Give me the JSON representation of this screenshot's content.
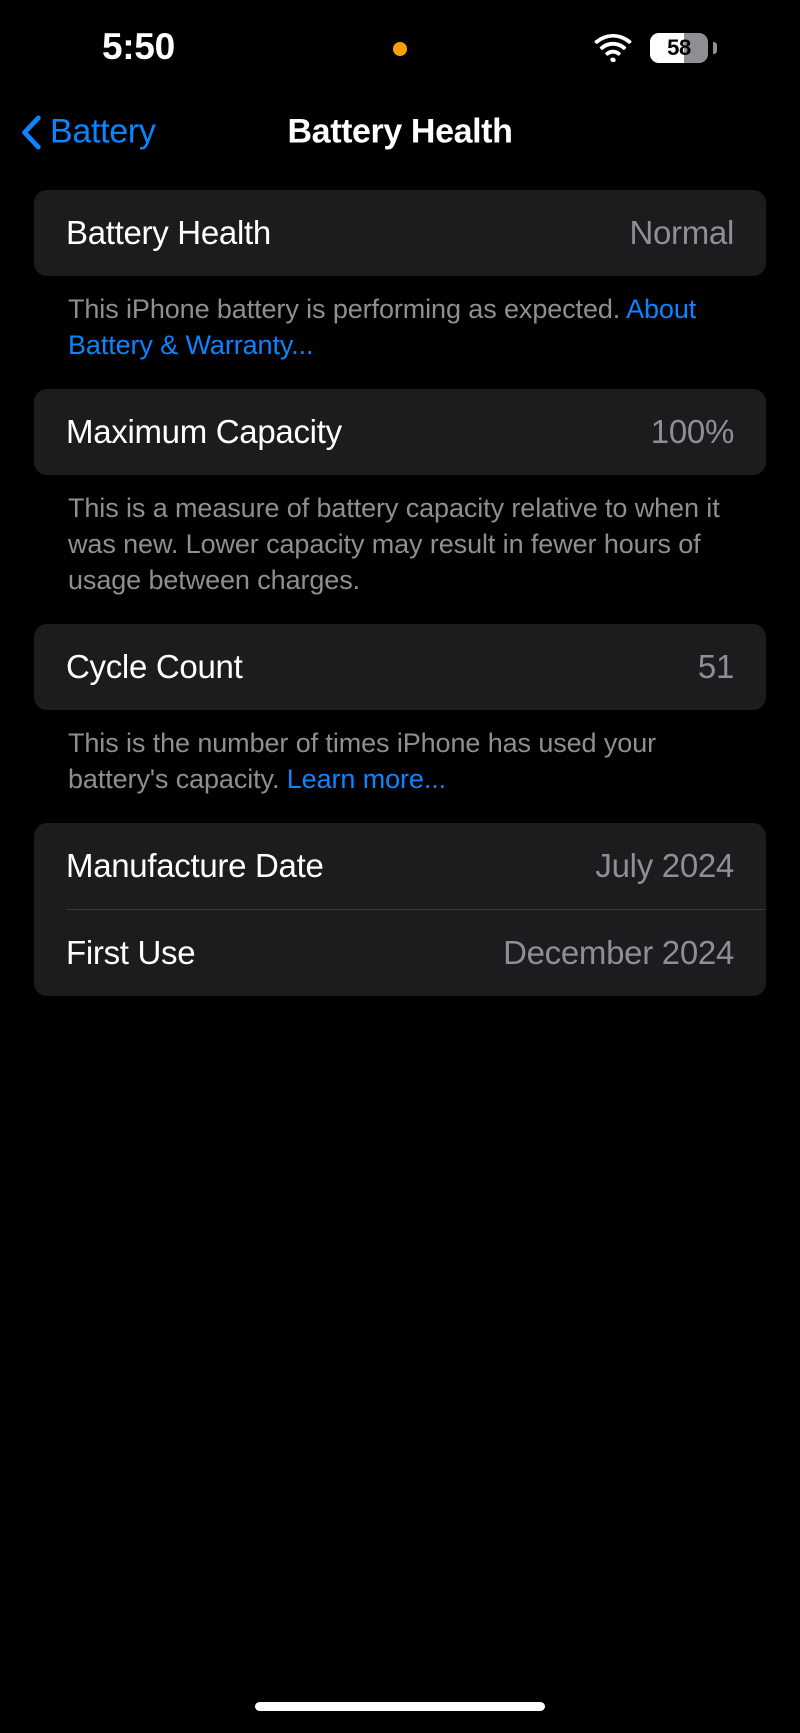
{
  "status_bar": {
    "time": "5:50",
    "privacy_indicator": "orange-dot",
    "wifi": "wifi-icon",
    "battery_percent_label": "58",
    "battery_level": 58
  },
  "nav": {
    "back_label": "Battery",
    "title": "Battery Health"
  },
  "sections": [
    {
      "rows": [
        {
          "label": "Battery Health",
          "value": "Normal"
        }
      ],
      "footer": {
        "text": "This iPhone battery is performing as expected. ",
        "link": "About Battery & Warranty..."
      }
    },
    {
      "rows": [
        {
          "label": "Maximum Capacity",
          "value": "100%"
        }
      ],
      "footer": {
        "text": "This is a measure of battery capacity relative to when it was new. Lower capacity may result in fewer hours of usage between charges.",
        "link": ""
      }
    },
    {
      "rows": [
        {
          "label": "Cycle Count",
          "value": "51"
        }
      ],
      "footer": {
        "text": "This is the number of times iPhone has used your battery's capacity. ",
        "link": "Learn more..."
      }
    },
    {
      "rows": [
        {
          "label": "Manufacture Date",
          "value": "July 2024"
        },
        {
          "label": "First Use",
          "value": "December 2024"
        }
      ],
      "footer": {
        "text": "",
        "link": ""
      }
    }
  ],
  "colors": {
    "background": "#000000",
    "card": "#1c1c1e",
    "accent_blue": "#0a84ff",
    "secondary_text": "#8e8e93",
    "privacy_orange": "#ff9f0a",
    "divider": "#38383a"
  },
  "home_indicator": "home-indicator"
}
